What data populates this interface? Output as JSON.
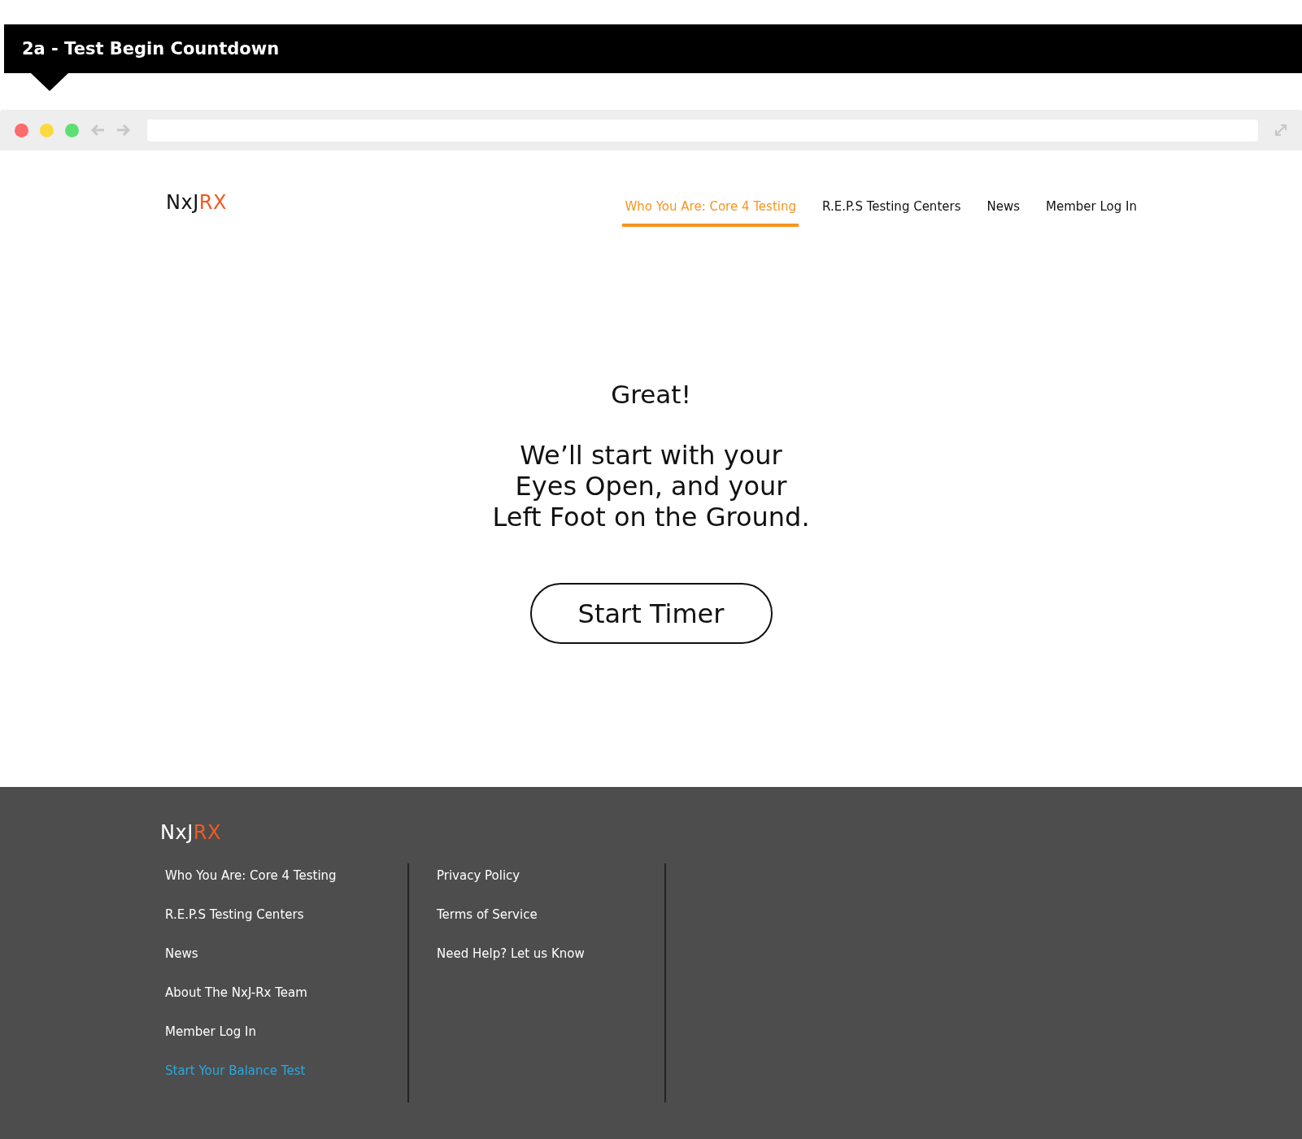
{
  "banner": {
    "title": "2a - Test Begin Countdown"
  },
  "header": {
    "logo": {
      "primary": "NxJ",
      "accent": "RX"
    },
    "nav": [
      {
        "label": "Who You Are: Core 4 Testing",
        "selected": true
      },
      {
        "label": "R.E.P.S Testing Centers",
        "selected": false
      },
      {
        "label": "News",
        "selected": false
      },
      {
        "label": "Member Log In",
        "selected": false
      }
    ]
  },
  "main": {
    "heading": "Great!",
    "message_lines": [
      "We’ll start with your",
      "Eyes Open, and your",
      "Left Foot on the Ground."
    ],
    "button": "Start Timer"
  },
  "footer": {
    "logo": {
      "primary": "NxJ",
      "accent": "RX"
    },
    "columns": [
      [
        {
          "label": "Who You Are: Core 4 Testing",
          "highlighted": false
        },
        {
          "label": "R.E.P.S Testing Centers",
          "highlighted": false
        },
        {
          "label": "News",
          "highlighted": false
        },
        {
          "label": "About The NxJ-Rx Team",
          "highlighted": false
        },
        {
          "label": "Member Log In",
          "highlighted": false
        },
        {
          "label": "Start Your Balance Test",
          "highlighted": true
        }
      ],
      [
        {
          "label": "Privacy Policy",
          "highlighted": false
        },
        {
          "label": "Terms of Service",
          "highlighted": false
        },
        {
          "label": "Need Help? Let us Know",
          "highlighted": false
        }
      ]
    ]
  }
}
